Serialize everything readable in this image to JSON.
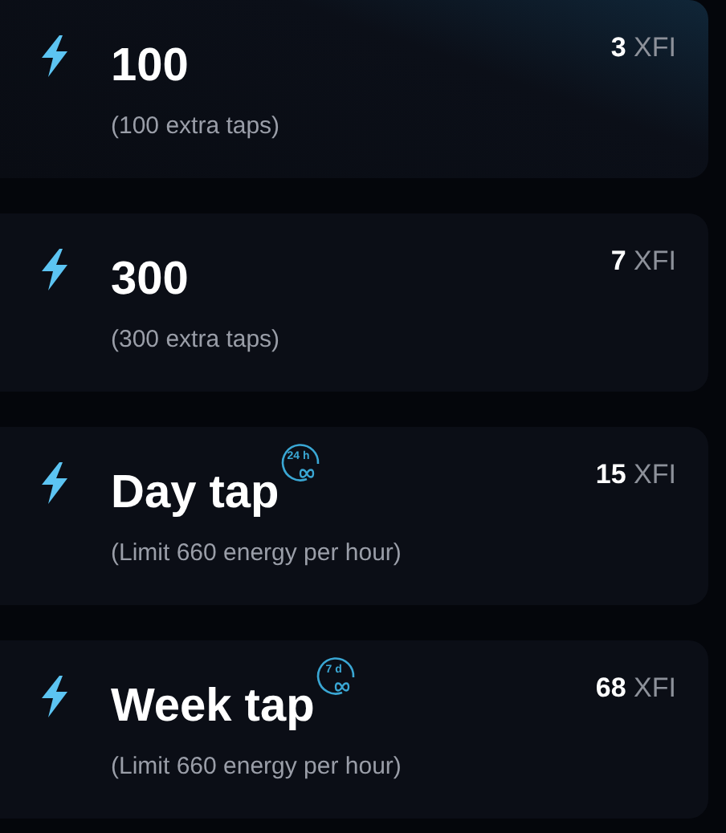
{
  "offers": [
    {
      "title": "100",
      "note": "(100 extra taps)",
      "amount": "3",
      "currency": "XFI"
    },
    {
      "title": "300",
      "note": "(300 extra taps)",
      "amount": "7",
      "currency": "XFI"
    },
    {
      "title": "Day tap",
      "note": "(Limit 660 energy per hour)",
      "amount": "15",
      "currency": "XFI",
      "badge": "24 h"
    },
    {
      "title": "Week tap",
      "note": "(Limit 660 energy per hour)",
      "amount": "68",
      "currency": "XFI",
      "badge": "7 d"
    }
  ]
}
